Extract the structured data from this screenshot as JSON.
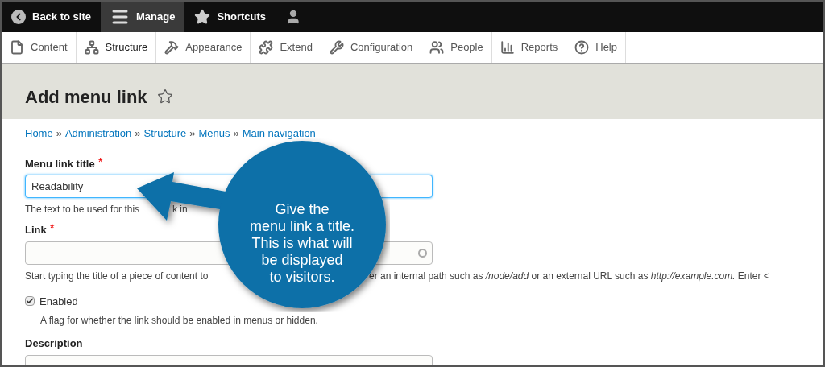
{
  "toolbar": {
    "items": [
      {
        "kind": "back",
        "label": "Back to site",
        "selected": false
      },
      {
        "kind": "manage",
        "label": "Manage",
        "selected": true
      },
      {
        "kind": "shortcuts",
        "label": "Shortcuts",
        "selected": false
      },
      {
        "kind": "user",
        "selected": false
      }
    ]
  },
  "tray": {
    "items": [
      {
        "kind": "content",
        "label": "Content",
        "selected": false
      },
      {
        "kind": "structure",
        "label": "Structure",
        "selected": true
      },
      {
        "kind": "appearance",
        "label": "Appearance",
        "selected": false
      },
      {
        "kind": "extend",
        "label": "Extend",
        "selected": false
      },
      {
        "kind": "configuration",
        "label": "Configuration",
        "selected": false
      },
      {
        "kind": "people",
        "label": "People",
        "selected": false
      },
      {
        "kind": "reports",
        "label": "Reports",
        "selected": false
      },
      {
        "kind": "help",
        "label": "Help",
        "selected": false
      }
    ]
  },
  "page": {
    "title": "Add menu link",
    "breadcrumb": {
      "separator": "»",
      "items": [
        "Home",
        "Administration",
        "Structure",
        "Menus",
        "Main navigation"
      ]
    }
  },
  "form": {
    "required_mark": "*",
    "fields": [
      {
        "kind": "text",
        "label": "Menu link title",
        "required": true,
        "value": "Readability",
        "focused": true,
        "description": [
          "The text to be used for this",
          "k in"
        ]
      },
      {
        "kind": "autocomplete",
        "label": "Link",
        "required": true,
        "focused": false,
        "description": [
          "Start typing the title of a piece of content to",
          "er an internal path such as */node/add* or an external URL such as *http://example.com.* Enter <"
        ]
      },
      {
        "kind": "checkbox",
        "label": "Enabled",
        "checked": true,
        "description": [
          "A flag for whether the link should be enabled in menus or hidden."
        ]
      },
      {
        "kind": "textarea",
        "label": "Description",
        "required": false
      }
    ]
  },
  "callout": {
    "lines": [
      "Give the",
      "menu link a title.",
      "This is what will",
      "be displayed",
      "to visitors."
    ]
  }
}
